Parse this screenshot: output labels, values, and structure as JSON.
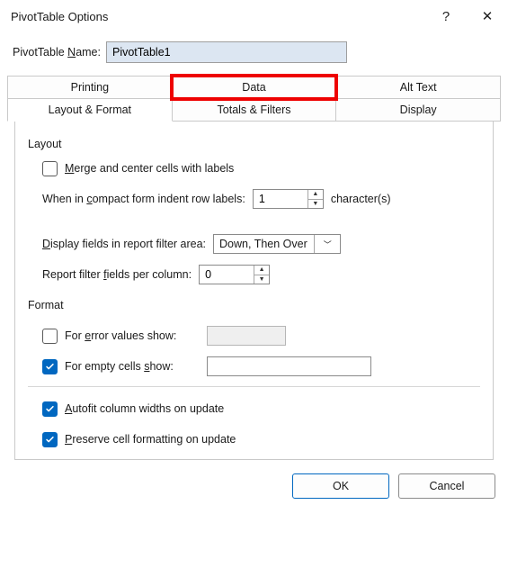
{
  "dialog": {
    "title": "PivotTable Options",
    "help_symbol": "?",
    "close_symbol": "✕"
  },
  "name_field": {
    "label_pre": "PivotTable ",
    "label_ul": "N",
    "label_post": "ame:",
    "value": "PivotTable1"
  },
  "tabs": {
    "row1": [
      "Printing",
      "Data",
      "Alt Text"
    ],
    "row2": [
      "Layout & Format",
      "Totals & Filters",
      "Display"
    ],
    "active": "Layout & Format",
    "highlighted": "Data"
  },
  "layout_section": {
    "title": "Layout",
    "merge_checkbox": {
      "checked": false,
      "pre": "",
      "ul": "M",
      "post": "erge and center cells with labels"
    },
    "indent": {
      "pre": "When in ",
      "ul": "c",
      "post": "ompact form indent row labels:",
      "value": "1",
      "suffix": "character(s)"
    },
    "display_fields": {
      "pre": "",
      "ul": "D",
      "post": "isplay fields in report filter area:",
      "value": "Down, Then Over"
    },
    "filter_fields": {
      "pre": "Report filter ",
      "ul": "f",
      "post": "ields per column:",
      "value": "0"
    }
  },
  "format_section": {
    "title": "Format",
    "error_values": {
      "checked": false,
      "pre": "For ",
      "ul": "e",
      "post": "rror values show:",
      "value": ""
    },
    "empty_cells": {
      "checked": true,
      "pre": "For empty cells ",
      "ul": "s",
      "post": "how:",
      "value": ""
    },
    "autofit": {
      "checked": true,
      "ul": "A",
      "post": "utofit column widths on update"
    },
    "preserve": {
      "checked": true,
      "ul": "P",
      "post": "reserve cell formatting on update"
    }
  },
  "footer": {
    "ok": "OK",
    "cancel": "Cancel"
  }
}
